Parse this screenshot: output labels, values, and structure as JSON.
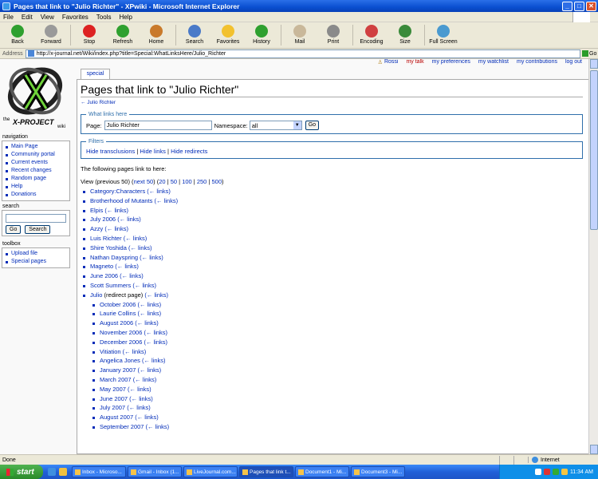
{
  "window": {
    "title": "Pages that link to \"Julio Richter\" - XPwiki - Microsoft Internet Explorer",
    "controls": [
      "_",
      "□",
      "✕"
    ]
  },
  "menubar": [
    "File",
    "Edit",
    "View",
    "Favorites",
    "Tools",
    "Help"
  ],
  "toolbar": [
    {
      "label": "Back",
      "icon": "back-arrow-icon",
      "color": "#2fa02f"
    },
    {
      "label": "Forward",
      "icon": "forward-arrow-icon",
      "color": "#9a9a9a"
    },
    {
      "label": "Stop",
      "icon": "stop-icon",
      "color": "#d22"
    },
    {
      "label": "Refresh",
      "icon": "refresh-icon",
      "color": "#2fa02f"
    },
    {
      "label": "Home",
      "icon": "home-icon",
      "color": "#c97a2b"
    },
    {
      "label": "Search",
      "icon": "search-icon",
      "color": "#4a7ac8"
    },
    {
      "label": "Favorites",
      "icon": "star-icon",
      "color": "#f2c12e"
    },
    {
      "label": "History",
      "icon": "history-icon",
      "color": "#2fa02f"
    },
    {
      "label": "Mail",
      "icon": "mail-icon",
      "color": "#c9b89a"
    },
    {
      "label": "Print",
      "icon": "printer-icon",
      "color": "#8a8a8a"
    },
    {
      "label": "Encoding",
      "icon": "encoding-icon",
      "color": "#d04040"
    },
    {
      "label": "Size",
      "icon": "text-size-icon",
      "color": "#3a8a3a"
    },
    {
      "label": "Full Screen",
      "icon": "full-screen-icon",
      "color": "#4a9ad0"
    }
  ],
  "address": {
    "label": "Address",
    "url": "http://x-journal.net/Wiki/index.php?title=Special:WhatLinksHere/Julio_Richter",
    "go": "Go"
  },
  "ptools": {
    "user": "Rossi",
    "talk": "my talk",
    "prefs": "my preferences",
    "watchlist": "my watchlist",
    "contribs": "my contributions",
    "logout": "log out"
  },
  "logo": {
    "text_the": "the",
    "text_main": "X-PROJECT",
    "text_wiki": "wiki"
  },
  "sidebar": {
    "navigation_title": "navigation",
    "navigation": [
      "Main Page",
      "Community portal",
      "Current events",
      "Recent changes",
      "Random page",
      "Help",
      "Donations"
    ],
    "search_title": "search",
    "search_go": "Go",
    "search_search": "Search",
    "toolbox_title": "toolbox",
    "toolbox": [
      "Upload file",
      "Special pages"
    ]
  },
  "content": {
    "tab": "special",
    "heading": "Pages that link to \"Julio Richter\"",
    "subtitle": "← Julio Richter",
    "whatlinks_legend": "What links here",
    "page_label": "Page:",
    "page_value": "Julio Richter",
    "namespace_label": "Namespace:",
    "namespace_value": "all",
    "go": "Go",
    "filters_legend": "Filters",
    "filters": [
      "Hide transclusions",
      "Hide links",
      "Hide redirects"
    ],
    "following": "The following pages link to here:",
    "nav_view": "View (previous 50) (",
    "nav_next": "next 50",
    "nav_mid": ") (",
    "nav_counts": [
      "20",
      "50",
      "100",
      "250",
      "500"
    ],
    "nav_end": ")",
    "links_suffix": "(← links)",
    "redirect_note": "(redirect page)",
    "pages": [
      "Category:Characters",
      "Brotherhood of Mutants",
      "Elpis",
      "July 2006",
      "Azzy",
      "Luis Richter",
      "Shire Yoshida",
      "Nathan Dayspring",
      "Magneto",
      "June 2006",
      "Scott Summers",
      "Julio"
    ],
    "redirect_pages": [
      "October 2006",
      "Laurie Collins",
      "August 2006",
      "November 2006",
      "December 2006",
      "Vitiation",
      "Angelica Jones",
      "January 2007",
      "March 2007",
      "May 2007",
      "June 2007",
      "July 2007",
      "August 2007",
      "September 2007"
    ]
  },
  "status": {
    "text": "Done",
    "zone": "Internet"
  },
  "taskbar": {
    "start": "start",
    "tasks": [
      "Inbox - Microso...",
      "Gmail - Inbox (1...",
      "LiveJournal.com...",
      "Pages that link t...",
      "Document1 - Mi...",
      "Document3 - Mi..."
    ],
    "active_index": 3,
    "clock": "11:34 AM"
  }
}
